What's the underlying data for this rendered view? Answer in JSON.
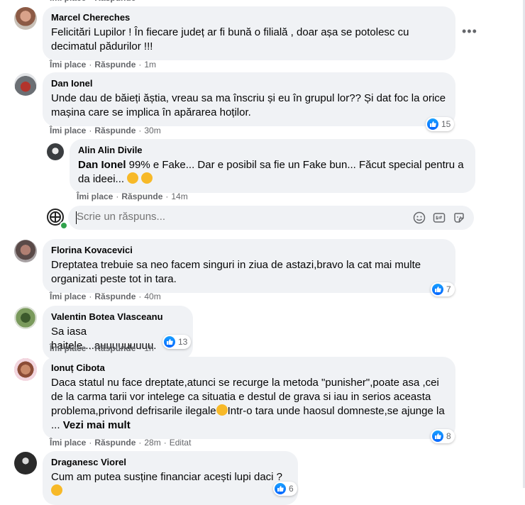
{
  "actions": {
    "like": "Îmi place",
    "reply": "Răspunde",
    "edited": "Editat"
  },
  "comments": [
    {
      "name": "Marcel Chereches",
      "text": "Felicitări Lupilor ! În fiecare județ ar fi bună o filială , doar așa se potolesc cu decimatul pădurilor !!!",
      "time": "1m"
    },
    {
      "name": "Dan Ionel",
      "text": "Unde dau de băieți ăștia, vreau sa ma înscriu și eu în grupul lor?? Și dat foc la orice mașina care se implica în apărarea hoților.",
      "time": "30m",
      "reactions": "15"
    },
    {
      "name": "Alin Alin Divile",
      "mention": "Dan Ionel",
      "text": " 99% e Fake... Dar e posibil sa fie un Fake bun... Făcut special pentru a da ideei...",
      "time": "14m"
    },
    {
      "name": "Florina Kovacevici",
      "text": "Dreptatea trebuie sa neo facem singuri in ziua de astazi,bravo la cat mai multe organizati peste tot in tara.",
      "time": "40m",
      "reactions": "7"
    },
    {
      "name": "Valentin Botea Vlasceanu",
      "text": "Sa iasa haitele....auuuuuuuuu.",
      "time": "1h",
      "reactions": "13"
    },
    {
      "name": "Ionuț Cibota",
      "text": "Daca statul nu face dreptate,atunci se recurge la metoda \"punisher\",poate asa ,cei de la carma tarii vor intelege ca situatia e destul de grava si iau in serios aceasta problema,privond defrisarile ilegale",
      "text2": "Intr-o tara unde haosul domneste,se ajunge la ...",
      "more": "Vezi mai mult",
      "time": "28m",
      "reactions": "8"
    },
    {
      "name": "Draganesc Viorel",
      "text": "Cum am putea susține financiar acești lupi daci ?",
      "reactions": "6"
    }
  ],
  "reply": {
    "placeholder": "Scrie un răspuns..."
  },
  "icons": {
    "more": "more-horizontal-icon",
    "like": "like-thumb-icon",
    "emoji": "emoji-icon",
    "gif": "gif-icon",
    "sticker": "sticker-icon",
    "avatar": "page-avatar-icon"
  },
  "colors": {
    "bubble": "#f0f2f5",
    "like_blue": "#0866ff",
    "meta_gray": "#65676b"
  }
}
